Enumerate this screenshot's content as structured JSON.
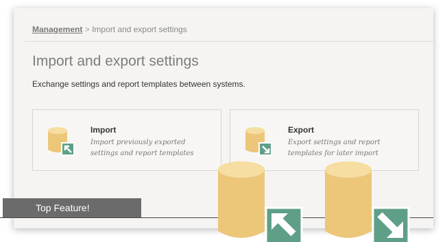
{
  "breadcrumb": {
    "root": "Management",
    "separator": ">",
    "current": "Import and export settings"
  },
  "page": {
    "title": "Import and export settings",
    "subtitle": "Exchange settings and report templates between systems."
  },
  "cards": [
    {
      "title": "Import",
      "description": "Import previously exported settings and report templates",
      "icon": "database-import-icon"
    },
    {
      "title": "Export",
      "description": "Export settings and report templates for later import",
      "icon": "database-export-icon"
    }
  ],
  "banner": {
    "label": "Top Feature!"
  },
  "colors": {
    "database": "#ecc77a",
    "database_top": "#f6dea2",
    "arrow_badge": "#5f9f88",
    "banner": "#6b6b6b",
    "panel": "#f5f4f2"
  }
}
